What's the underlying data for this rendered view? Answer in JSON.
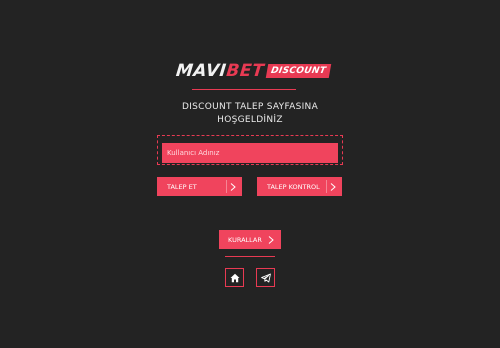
{
  "brand": {
    "logo_main": "MAVI",
    "logo_accent": "BET",
    "logo_tag": "DISCOUNT"
  },
  "welcome": {
    "line1": "DISCOUNT TALEP SAYFASINA",
    "line2": "HOŞGELDİNİZ"
  },
  "form": {
    "username_placeholder": "Kullanıcı Adınız",
    "username_value": ""
  },
  "buttons": {
    "talep_et": "TALEP ET",
    "talep_kontrol": "TALEP KONTROL",
    "kurallar": "KURALLAR"
  },
  "icons": {
    "home": "home-icon",
    "telegram": "telegram-icon",
    "chevron": "chevron-right-icon"
  },
  "colors": {
    "background": "#232323",
    "accent": "#e83a53",
    "button": "#f0445d"
  }
}
